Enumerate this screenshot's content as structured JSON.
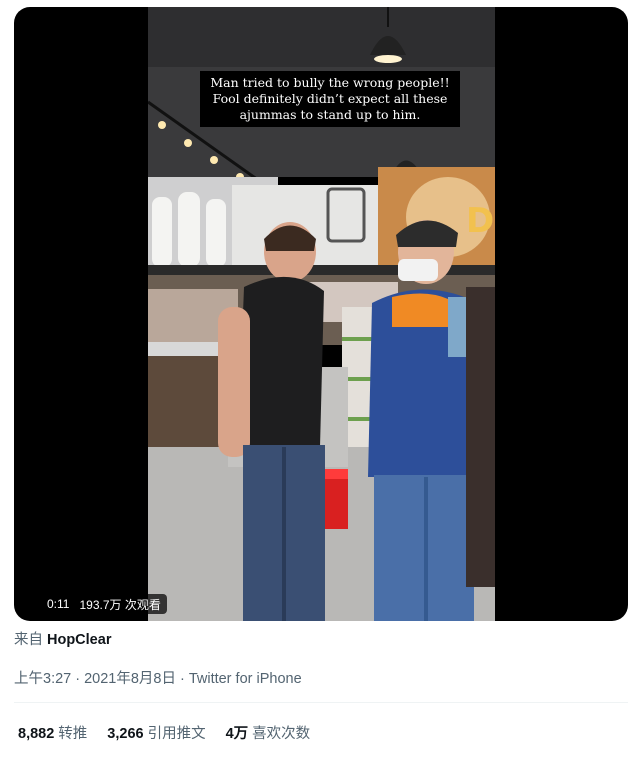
{
  "video": {
    "caption_lines": [
      "Man tried to bully the wrong people!!",
      "Fool definitely didn’t expect all these",
      "ajummas to stand up to him."
    ],
    "duration": "0:11",
    "views": "193.7万 次观看"
  },
  "tweet": {
    "source_prefix": "来自",
    "source_name": "HopClear",
    "time": "上午3:27",
    "date": "2021年8月8日",
    "client": "Twitter for iPhone",
    "separator": "·"
  },
  "stats": {
    "retweets_num": "8,882",
    "retweets_label": "转推",
    "quotes_num": "3,266",
    "quotes_label": "引用推文",
    "likes_num": "4万",
    "likes_label": "喜欢次数"
  },
  "colors": {
    "text_primary": "#0f1419",
    "text_secondary": "#536471",
    "divider": "#eff3f4"
  }
}
